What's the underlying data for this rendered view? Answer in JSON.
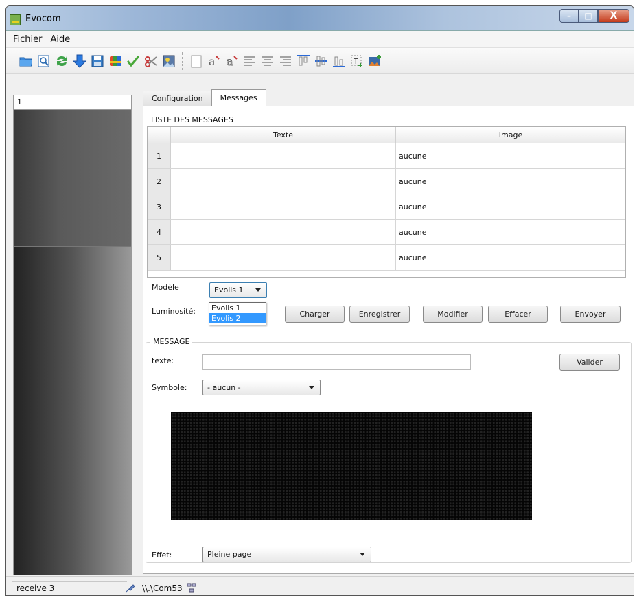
{
  "window": {
    "title": "Evocom",
    "controls": {
      "minimize": "–",
      "maximize": "□",
      "close": "X"
    }
  },
  "menu": {
    "items": [
      "Fichier",
      "Aide"
    ]
  },
  "toolbar": {
    "icons": [
      "open-folder-icon",
      "preview-icon",
      "refresh-icon",
      "download-icon",
      "save-icon",
      "palette-icon",
      "check-icon",
      "scissors-icon",
      "image-edit-icon",
      "blank-page-icon",
      "text-style-icon",
      "text-outline-icon",
      "align-left-icon",
      "align-center-icon",
      "align-right-icon",
      "valign-top-icon",
      "valign-middle-icon",
      "valign-bottom-icon",
      "insert-text-icon",
      "insert-image-icon"
    ]
  },
  "left_panel": {
    "field_value": "1"
  },
  "tabs": [
    {
      "label": "Configuration"
    },
    {
      "label": "Messages"
    }
  ],
  "active_tab": "Messages",
  "messages_list": {
    "group_title": "LISTE DES MESSAGES",
    "columns": [
      "Texte",
      "Image"
    ],
    "rows": [
      {
        "num": "1",
        "texte": "",
        "image": "aucune"
      },
      {
        "num": "2",
        "texte": "",
        "image": "aucune"
      },
      {
        "num": "3",
        "texte": "",
        "image": "aucune"
      },
      {
        "num": "4",
        "texte": "",
        "image": "aucune"
      },
      {
        "num": "5",
        "texte": "",
        "image": "aucune"
      }
    ]
  },
  "controls": {
    "modele_label": "Modèle",
    "modele_value": "Evolis 1",
    "modele_options": [
      "Evolis 1",
      "Evolis 2"
    ],
    "modele_highlighted": "Evolis 2",
    "luminosite_label": "Luminosité:",
    "buttons": {
      "charger": "Charger",
      "enregistrer": "Enregistrer",
      "modifier": "Modifier",
      "effacer": "Effacer",
      "envoyer": "Envoyer"
    }
  },
  "message": {
    "group_title": "MESSAGE",
    "texte_label": "texte:",
    "texte_value": "",
    "valider": "Valider",
    "symbole_label": "Symbole:",
    "symbole_value": "- aucun -",
    "effet_label": "Effet:",
    "effet_value": "Pleine page"
  },
  "statusbar": {
    "left": "receive 3",
    "port": "\\\\.\\Com53"
  },
  "colors": {
    "led_background": "#050505",
    "selection": "#3399ff"
  }
}
